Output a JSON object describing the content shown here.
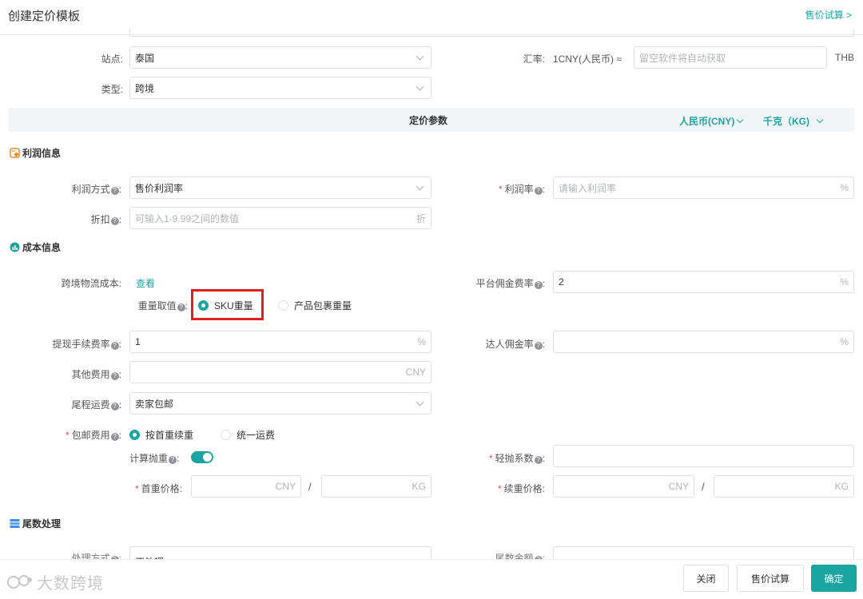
{
  "header": {
    "title": "创建定价模板",
    "trial_link": "售价试算 >"
  },
  "site": {
    "label": "站点:",
    "value": "泰国"
  },
  "type": {
    "label": "类型:",
    "value": "跨境"
  },
  "exchange": {
    "label": "汇率:",
    "prefix": "1CNY(人民币) ≈",
    "placeholder": "留空软件将自动获取",
    "unit": "THB"
  },
  "pricing_bar": {
    "title": "定价参数",
    "currency": "人民币(CNY)",
    "weight_unit": "千克（KG)"
  },
  "profit": {
    "heading": "利润信息",
    "method_label": "利润方式",
    "method_value": "售价利润率",
    "rate_label": "利润率",
    "rate_placeholder": "请输入利润率",
    "rate_unit": "%",
    "discount_label": "折扣",
    "discount_placeholder": "可输入1-9.99之间的数值",
    "discount_unit": "折"
  },
  "cost": {
    "heading": "成本信息",
    "logistics_label": "跨境物流成本:",
    "logistics_link": "查看",
    "weight_label": "重量取值",
    "weight_options": [
      "SKU重量",
      "产品包裹重量"
    ],
    "platform_label": "平台佣金费率",
    "platform_value": "2",
    "platform_unit": "%",
    "withdraw_label": "提现手续费率",
    "withdraw_value": "1",
    "withdraw_unit": "%",
    "influencer_label": "达人佣金率",
    "influencer_unit": "%",
    "other_label": "其他费用",
    "other_unit": "CNY",
    "lastmile_label": "尾程运费",
    "lastmile_value": "卖家包邮",
    "freeship_label": "包邮费用",
    "freeship_options": [
      "按首重续重",
      "统一运费"
    ],
    "volume_label": "计算抛重",
    "light_label": "轻抛系数",
    "first_label": "首重价格:",
    "first_unit_a": "CNY",
    "slash": "/",
    "first_unit_b": "KG",
    "cont_label": "续重价格:",
    "cont_unit_a": "CNY",
    "cont_unit_b": "KG"
  },
  "tail": {
    "heading": "尾数处理",
    "method_label": "处理方式",
    "method_value": "不处理",
    "amount_label": "尾数金额"
  },
  "footer": {
    "close": "关闭",
    "trial": "售价试算",
    "confirm": "确定",
    "watermark": "大数跨境"
  },
  "colors": {
    "accent": "#1aa5a0",
    "highlight": "#e02020",
    "required": "#e34d4d"
  }
}
